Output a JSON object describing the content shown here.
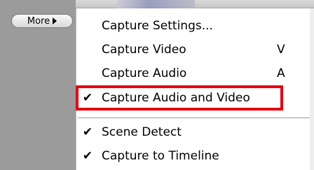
{
  "more_button": {
    "label": "More",
    "icon": "triangle-right-icon"
  },
  "menu": {
    "items": [
      {
        "label": "Capture Settings...",
        "checked": false,
        "shortcut": ""
      },
      {
        "label": "Capture Video",
        "checked": false,
        "shortcut": "V"
      },
      {
        "label": "Capture Audio",
        "checked": false,
        "shortcut": "A"
      },
      {
        "label": "Capture Audio and Video",
        "checked": true,
        "shortcut": ""
      },
      {
        "label": "Scene Detect",
        "checked": true,
        "shortcut": ""
      },
      {
        "label": "Capture to Timeline",
        "checked": true,
        "shortcut": ""
      }
    ],
    "check_glyph": "✔"
  },
  "annotation": {
    "highlight_color": "#e60012",
    "highlighted_item": "Capture Audio and Video"
  }
}
